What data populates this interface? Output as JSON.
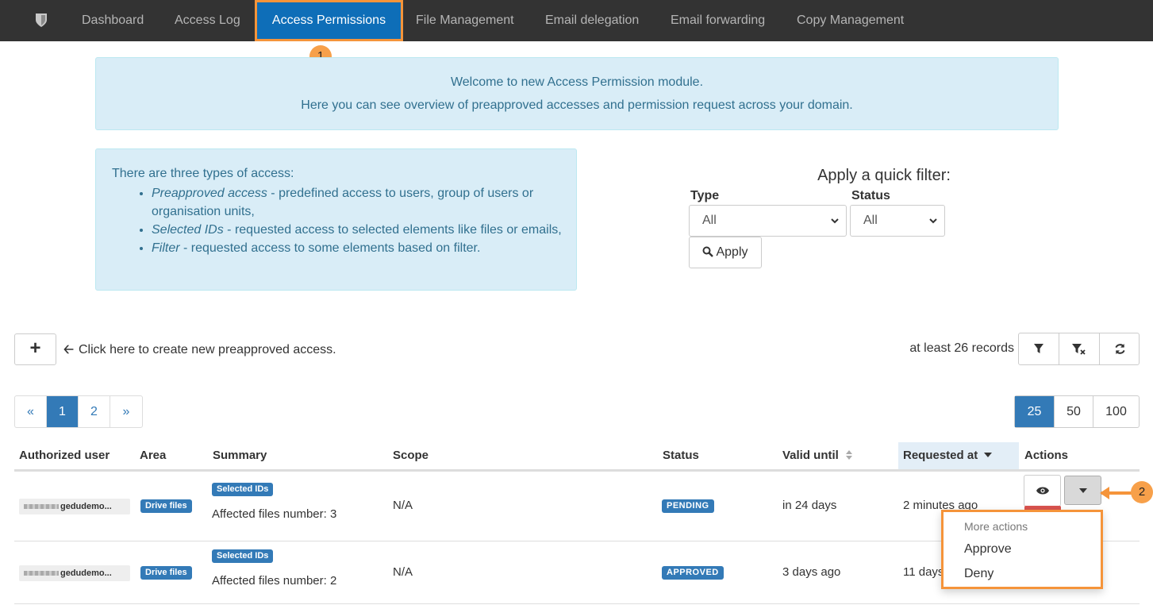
{
  "nav": {
    "items": [
      {
        "label": "Dashboard"
      },
      {
        "label": "Access Log"
      },
      {
        "label": "Access Permissions"
      },
      {
        "label": "File Management"
      },
      {
        "label": "Email delegation"
      },
      {
        "label": "Email forwarding"
      },
      {
        "label": "Copy Management"
      }
    ],
    "active_index": 2
  },
  "callouts": {
    "one": "1",
    "two": "2"
  },
  "welcome": {
    "line1": "Welcome to new Access Permission module.",
    "line2": "Here you can see overview of preapproved accesses and permission request across your domain."
  },
  "types_info": {
    "intro": "There are three types of access:",
    "items": [
      {
        "term": "Preapproved access",
        "desc": " - predefined access to users, group of users or organisation units,"
      },
      {
        "term": "Selected IDs",
        "desc": " - requested access to selected elements like files or emails,"
      },
      {
        "term": "Filter",
        "desc": " - requested access to some elements based on filter."
      }
    ]
  },
  "quick_filter": {
    "title": "Apply a quick filter:",
    "type_label": "Type",
    "type_value": "All",
    "status_label": "Status",
    "status_value": "All",
    "apply_label": "Apply"
  },
  "toolbar": {
    "add_label": "+",
    "hint": "Click here to create new preapproved access.",
    "records": "at least 26 records",
    "icons": [
      "filter-icon",
      "clear-filter-icon",
      "refresh-icon"
    ]
  },
  "pagination": {
    "prev": "«",
    "pages": [
      "1",
      "2"
    ],
    "next": "»",
    "active": "1",
    "page_sizes": [
      "25",
      "50",
      "100"
    ],
    "active_size": "25"
  },
  "table": {
    "headers": {
      "user": "Authorized user",
      "area": "Area",
      "summary": "Summary",
      "scope": "Scope",
      "status": "Status",
      "valid": "Valid until",
      "requested": "Requested at",
      "actions": "Actions"
    },
    "rows": [
      {
        "user": "gedudemo...",
        "area": "Drive files",
        "summary_badge": "Selected IDs",
        "summary_text": "Affected files number: 3",
        "scope": "N/A",
        "status": "PENDING",
        "valid": "in 24 days",
        "requested": "2 minutes ago"
      },
      {
        "user": "gedudemo...",
        "area": "Drive files",
        "summary_badge": "Selected IDs",
        "summary_text": "Affected files number: 2",
        "scope": "N/A",
        "status": "APPROVED",
        "valid": "3 days ago",
        "requested": "11 days"
      }
    ]
  },
  "dropdown": {
    "header": "More actions",
    "approve": "Approve",
    "deny": "Deny"
  },
  "colors": {
    "accent": "#337ab7",
    "nav_bg": "#333333",
    "highlight": "#f5943a",
    "info_bg": "#d9edf7"
  }
}
